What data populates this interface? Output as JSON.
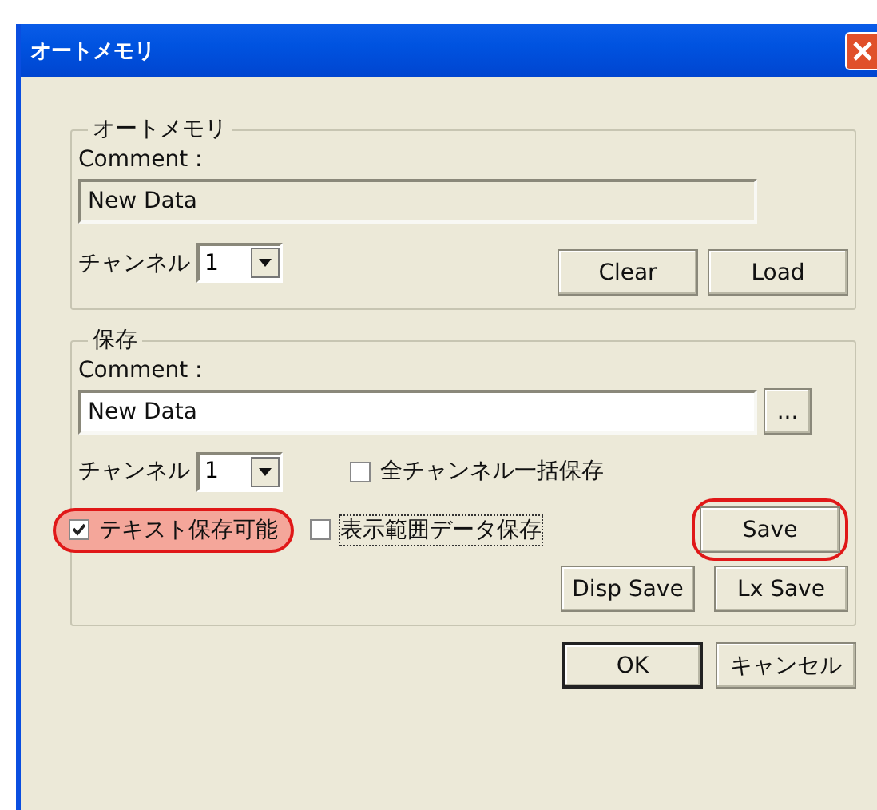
{
  "window": {
    "title": "オートメモリ"
  },
  "memory_group": {
    "legend": "オートメモリ",
    "comment_label": "Comment :",
    "comment_value": "New Data",
    "channel_label": "チャンネル",
    "channel_value": "1",
    "buttons": [
      {
        "label": "Clear"
      },
      {
        "label": "Load"
      }
    ]
  },
  "save_group": {
    "legend": "保存",
    "comment_label": "Comment :",
    "comment_value": "New Data",
    "browse_label": "...",
    "channel_label": "チャンネル",
    "channel_value": "1",
    "checkboxes": [
      {
        "label": "全チャンネル一括保存",
        "checked": false,
        "focused": false,
        "highlighted": false
      },
      {
        "label": "テキスト保存可能",
        "checked": true,
        "focused": false,
        "highlighted": true
      },
      {
        "label": "表示範囲データ保存",
        "checked": false,
        "focused": true,
        "highlighted": false
      }
    ],
    "save_button": {
      "label": "Save",
      "highlighted": true
    },
    "buttons": [
      {
        "label": "Disp Save"
      },
      {
        "label": "Lx Save"
      }
    ]
  },
  "dialog_buttons": [
    {
      "label": "OK",
      "default": true
    },
    {
      "label": "キャンセル",
      "default": false
    }
  ]
}
